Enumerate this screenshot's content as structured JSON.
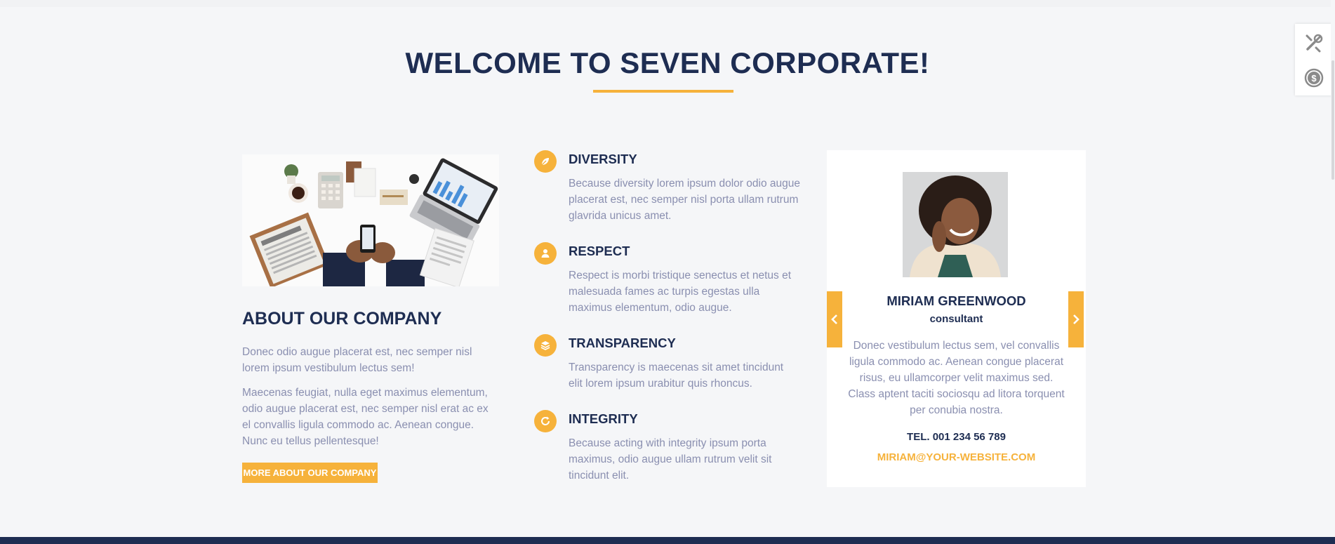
{
  "heading": {
    "title": "WELCOME TO SEVEN CORPORATE!"
  },
  "about": {
    "image_alt": "Business desk flat lay",
    "title": "ABOUT OUR COMPANY",
    "p1": "Donec odio augue placerat est, nec semper nisl lorem ipsum vestibulum lectus sem!",
    "p2": "Maecenas feugiat, nulla eget maximus elementum, odio augue placerat est, nec semper nisl erat ac ex el convallis ligula commodo ac. Aenean congue. Nunc eu tellus pellentesque!",
    "button": "MORE ABOUT OUR COMPANY"
  },
  "features": [
    {
      "icon": "leaf-icon",
      "title": "DIVERSITY",
      "text": "Because diversity lorem ipsum dolor odio augue placerat est, nec semper nisl porta ullam rutrum glavrida unicus amet."
    },
    {
      "icon": "user-icon",
      "title": "RESPECT",
      "text": "Respect is morbi tristique senectus et netus et malesuada fames ac turpis egestas ulla maximus elementum, odio augue."
    },
    {
      "icon": "layers-icon",
      "title": "TRANSPARENCY",
      "text": "Transparency is maecenas sit amet tincidunt elit lorem ipsum urabitur quis rhoncus."
    },
    {
      "icon": "refresh-icon",
      "title": "INTEGRITY",
      "text": "Because acting with integrity ipsum porta maximus, odio augue ullam rutrum velit sit tincidunt elit."
    }
  ],
  "team_card": {
    "name": "MIRIAM GREENWOOD",
    "role": "consultant",
    "bio": "Donec vestibulum lectus sem, vel convallis ligula commodo ac. Aenean congue placerat risus, eu ullamcorper velit maximus sed. Class aptent taciti sociosqu ad litora torquent per conubia nostra.",
    "tel": "TEL. 001 234 56 789",
    "email": "MIRIAM@YOUR-WEBSITE.COM"
  },
  "side_tools": [
    "tools-icon",
    "dollar-icon"
  ],
  "colors": {
    "accent": "#f6b23b",
    "navy": "#1e2d52",
    "muted_text": "#8a8fb0",
    "background": "#f5f6f8"
  }
}
